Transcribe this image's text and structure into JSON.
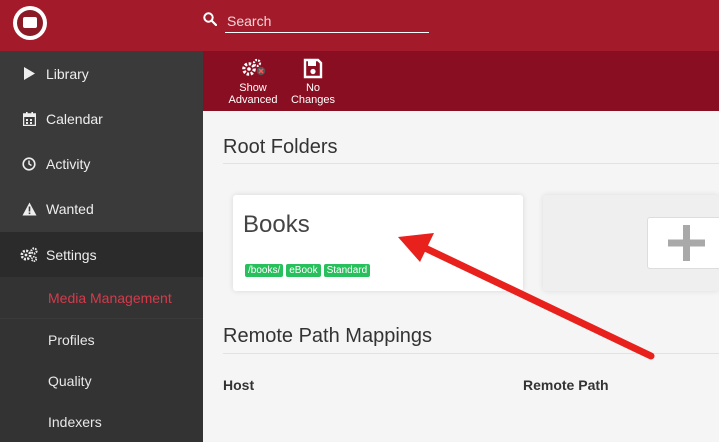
{
  "colors": {
    "accent": "#a31b2a",
    "toolbar": "#8a0e21",
    "sidebar": "#3a3a3a",
    "active_sub": "#d73a4b",
    "badge": "#27c05c",
    "annotation": "#e8211d"
  },
  "search": {
    "placeholder": "Search",
    "value": ""
  },
  "sidebar": {
    "items": [
      {
        "label": "Library",
        "icon": "play-icon"
      },
      {
        "label": "Calendar",
        "icon": "calendar-icon"
      },
      {
        "label": "Activity",
        "icon": "clock-icon"
      },
      {
        "label": "Wanted",
        "icon": "warning-icon"
      },
      {
        "label": "Settings",
        "icon": "gears-icon"
      }
    ],
    "subitems": [
      {
        "label": "Media Management",
        "active": true
      },
      {
        "label": "Profiles"
      },
      {
        "label": "Quality"
      },
      {
        "label": "Indexers"
      }
    ]
  },
  "toolbar": {
    "show_advanced": {
      "line1": "Show",
      "line2": "Advanced",
      "icon": "gears-x-icon"
    },
    "no_changes": {
      "line1": "No",
      "line2": "Changes",
      "icon": "save-icon"
    }
  },
  "main": {
    "root_folders_title": "Root Folders",
    "card": {
      "title": "Books",
      "badges": [
        "/books/",
        "eBook",
        "Standard"
      ]
    },
    "add_icon": "plus-icon",
    "remote_title": "Remote Path Mappings",
    "columns": [
      "Host",
      "Remote Path"
    ]
  }
}
